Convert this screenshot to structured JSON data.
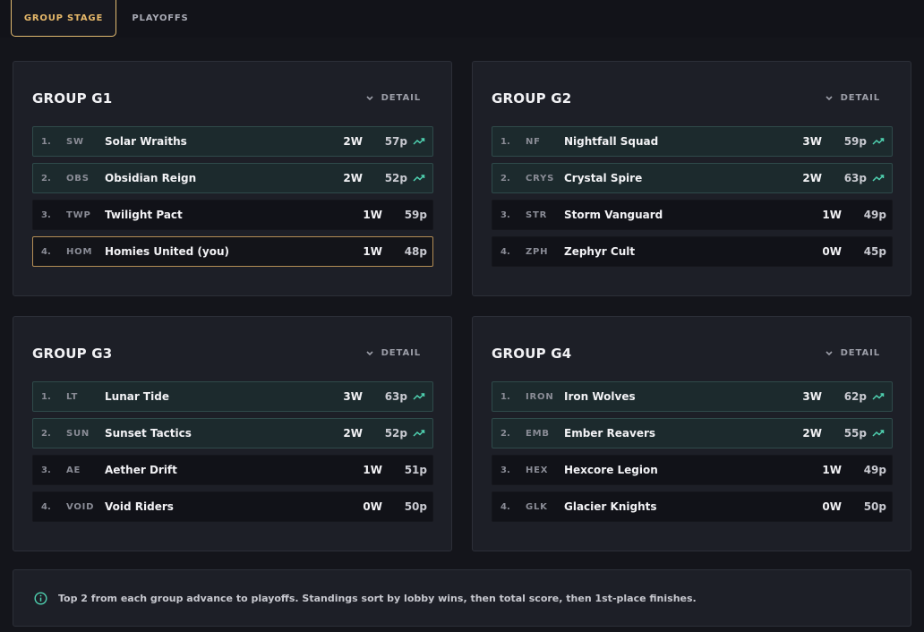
{
  "tabs": [
    {
      "label": "GROUP STAGE",
      "active": true
    },
    {
      "label": "PLAYOFFS",
      "active": false
    }
  ],
  "detail_label": "DETAIL",
  "colors": {
    "accent_gold": "#e6b86a",
    "advance_green": "#4fd1b0",
    "card_bg": "#1d1f27",
    "page_bg": "#14151b"
  },
  "groups": [
    {
      "title": "GROUP G1",
      "rows": [
        {
          "rank": "1.",
          "tag": "SW",
          "name": "Solar Wraiths",
          "wins": "2W",
          "points": "57p",
          "advancing": true,
          "you": false
        },
        {
          "rank": "2.",
          "tag": "OBS",
          "name": "Obsidian Reign",
          "wins": "2W",
          "points": "52p",
          "advancing": true,
          "you": false
        },
        {
          "rank": "3.",
          "tag": "TWP",
          "name": "Twilight Pact",
          "wins": "1W",
          "points": "59p",
          "advancing": false,
          "you": false
        },
        {
          "rank": "4.",
          "tag": "HOM",
          "name": "Homies United (you)",
          "wins": "1W",
          "points": "48p",
          "advancing": false,
          "you": true
        }
      ]
    },
    {
      "title": "GROUP G2",
      "rows": [
        {
          "rank": "1.",
          "tag": "NF",
          "name": "Nightfall Squad",
          "wins": "3W",
          "points": "59p",
          "advancing": true,
          "you": false
        },
        {
          "rank": "2.",
          "tag": "CRYS",
          "name": "Crystal Spire",
          "wins": "2W",
          "points": "63p",
          "advancing": true,
          "you": false
        },
        {
          "rank": "3.",
          "tag": "STR",
          "name": "Storm Vanguard",
          "wins": "1W",
          "points": "49p",
          "advancing": false,
          "you": false
        },
        {
          "rank": "4.",
          "tag": "ZPH",
          "name": "Zephyr Cult",
          "wins": "0W",
          "points": "45p",
          "advancing": false,
          "you": false
        }
      ]
    },
    {
      "title": "GROUP G3",
      "rows": [
        {
          "rank": "1.",
          "tag": "LT",
          "name": "Lunar Tide",
          "wins": "3W",
          "points": "63p",
          "advancing": true,
          "you": false
        },
        {
          "rank": "2.",
          "tag": "SUN",
          "name": "Sunset Tactics",
          "wins": "2W",
          "points": "52p",
          "advancing": true,
          "you": false
        },
        {
          "rank": "3.",
          "tag": "AE",
          "name": "Aether Drift",
          "wins": "1W",
          "points": "51p",
          "advancing": false,
          "you": false
        },
        {
          "rank": "4.",
          "tag": "VOID",
          "name": "Void Riders",
          "wins": "0W",
          "points": "50p",
          "advancing": false,
          "you": false
        }
      ]
    },
    {
      "title": "GROUP G4",
      "rows": [
        {
          "rank": "1.",
          "tag": "IRON",
          "name": "Iron Wolves",
          "wins": "3W",
          "points": "62p",
          "advancing": true,
          "you": false
        },
        {
          "rank": "2.",
          "tag": "EMB",
          "name": "Ember Reavers",
          "wins": "2W",
          "points": "55p",
          "advancing": true,
          "you": false
        },
        {
          "rank": "3.",
          "tag": "HEX",
          "name": "Hexcore Legion",
          "wins": "1W",
          "points": "49p",
          "advancing": false,
          "you": false
        },
        {
          "rank": "4.",
          "tag": "GLK",
          "name": "Glacier Knights",
          "wins": "0W",
          "points": "50p",
          "advancing": false,
          "you": false
        }
      ]
    }
  ],
  "info": {
    "icon": "info-circle-icon",
    "text": "Top 2 from each group advance to playoffs. Standings sort by lobby wins, then total score, then 1st-place finishes."
  }
}
